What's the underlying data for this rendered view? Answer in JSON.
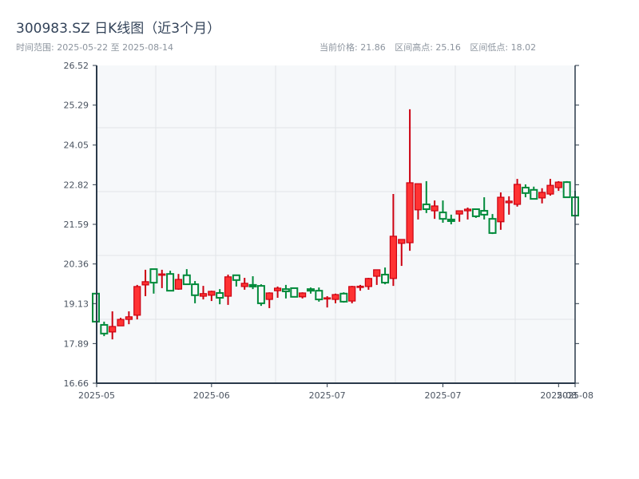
{
  "header": {
    "title": "300983.SZ 日K线图（近3个月）",
    "range_text": "时间范围: 2025-05-22 至 2025-08-14",
    "current_price": "当前价格: 21.86",
    "range_high": "区间高点: 25.16",
    "range_low": "区间低点: 18.02"
  },
  "chart_data": {
    "type": "candlestick",
    "ylim": [
      16.66,
      26.52
    ],
    "y_ticks": [
      "26.52",
      "25.29",
      "24.05",
      "22.82",
      "21.59",
      "20.36",
      "19.13",
      "17.89",
      "16.66"
    ],
    "x_ticks": [
      {
        "label": "2025-05",
        "index": 0
      },
      {
        "label": "2025-06",
        "index": 14
      },
      {
        "label": "2025-07",
        "index": 28
      },
      {
        "label": "2025-07",
        "index": 42
      },
      {
        "label": "2025-08",
        "index": 56
      },
      {
        "label": "2025-08",
        "index": 58
      }
    ],
    "grid": true,
    "colors": {
      "up": "#ff3333",
      "up_edge": "#cc0010",
      "down": "#008a3a",
      "background": "#f6f8fa",
      "axis": "#2b3a4a",
      "grid": "#e1e4e8"
    },
    "ohlc": [
      [
        19.44,
        19.44,
        18.57,
        18.57
      ],
      [
        18.47,
        18.57,
        18.12,
        18.2
      ],
      [
        18.25,
        18.89,
        18.02,
        18.42
      ],
      [
        18.44,
        18.69,
        18.44,
        18.64
      ],
      [
        18.64,
        18.89,
        18.49,
        18.72
      ],
      [
        18.77,
        19.71,
        18.64,
        19.66
      ],
      [
        19.71,
        20.18,
        19.36,
        19.81
      ],
      [
        20.2,
        20.2,
        19.44,
        19.78
      ],
      [
        20.01,
        20.18,
        19.61,
        20.05
      ],
      [
        20.05,
        20.15,
        19.51,
        19.53
      ],
      [
        19.58,
        20.05,
        19.56,
        19.88
      ],
      [
        20.01,
        20.2,
        19.71,
        19.73
      ],
      [
        19.73,
        19.83,
        19.14,
        19.39
      ],
      [
        19.36,
        19.68,
        19.26,
        19.44
      ],
      [
        19.39,
        19.53,
        19.21,
        19.51
      ],
      [
        19.46,
        19.58,
        19.11,
        19.31
      ],
      [
        19.36,
        20.03,
        19.09,
        19.96
      ],
      [
        20.01,
        20.01,
        19.66,
        19.86
      ],
      [
        19.66,
        19.93,
        19.56,
        19.76
      ],
      [
        19.71,
        19.98,
        19.58,
        19.66
      ],
      [
        19.68,
        19.73,
        19.06,
        19.14
      ],
      [
        19.26,
        19.48,
        18.99,
        19.46
      ],
      [
        19.53,
        19.66,
        19.31,
        19.61
      ],
      [
        19.58,
        19.71,
        19.29,
        19.51
      ],
      [
        19.61,
        19.61,
        19.34,
        19.34
      ],
      [
        19.34,
        19.48,
        19.29,
        19.46
      ],
      [
        19.58,
        19.63,
        19.44,
        19.53
      ],
      [
        19.53,
        19.63,
        19.19,
        19.26
      ],
      [
        19.29,
        19.36,
        19.01,
        19.31
      ],
      [
        19.26,
        19.44,
        19.14,
        19.41
      ],
      [
        19.44,
        19.48,
        19.16,
        19.19
      ],
      [
        19.21,
        19.68,
        19.14,
        19.66
      ],
      [
        19.63,
        19.71,
        19.53,
        19.67
      ],
      [
        19.66,
        19.93,
        19.56,
        19.91
      ],
      [
        19.98,
        20.18,
        19.71,
        20.18
      ],
      [
        20.03,
        20.25,
        19.73,
        19.78
      ],
      [
        19.91,
        22.53,
        19.68,
        21.22
      ],
      [
        21.0,
        21.12,
        20.3,
        21.12
      ],
      [
        21.02,
        25.16,
        20.77,
        22.88
      ],
      [
        22.04,
        22.85,
        21.74,
        22.85
      ],
      [
        22.21,
        22.93,
        21.94,
        22.06
      ],
      [
        22.01,
        22.33,
        21.76,
        22.16
      ],
      [
        21.96,
        22.33,
        21.64,
        21.76
      ],
      [
        21.74,
        21.89,
        21.59,
        21.69
      ],
      [
        21.91,
        22.01,
        21.67,
        22.01
      ],
      [
        22.01,
        22.11,
        21.74,
        22.06
      ],
      [
        22.06,
        22.06,
        21.79,
        21.84
      ],
      [
        22.01,
        22.43,
        21.74,
        21.89
      ],
      [
        21.76,
        21.91,
        21.29,
        21.32
      ],
      [
        21.67,
        22.58,
        21.42,
        22.43
      ],
      [
        22.26,
        22.46,
        21.89,
        22.31
      ],
      [
        22.21,
        23.0,
        22.14,
        22.83
      ],
      [
        22.73,
        22.83,
        22.43,
        22.56
      ],
      [
        22.66,
        22.76,
        22.38,
        22.38
      ],
      [
        22.41,
        22.71,
        22.24,
        22.58
      ],
      [
        22.53,
        23.0,
        22.48,
        22.8
      ],
      [
        22.73,
        22.93,
        22.63,
        22.9
      ],
      [
        22.9,
        22.93,
        22.43,
        22.43
      ],
      [
        22.43,
        22.63,
        21.84,
        21.86
      ]
    ]
  }
}
